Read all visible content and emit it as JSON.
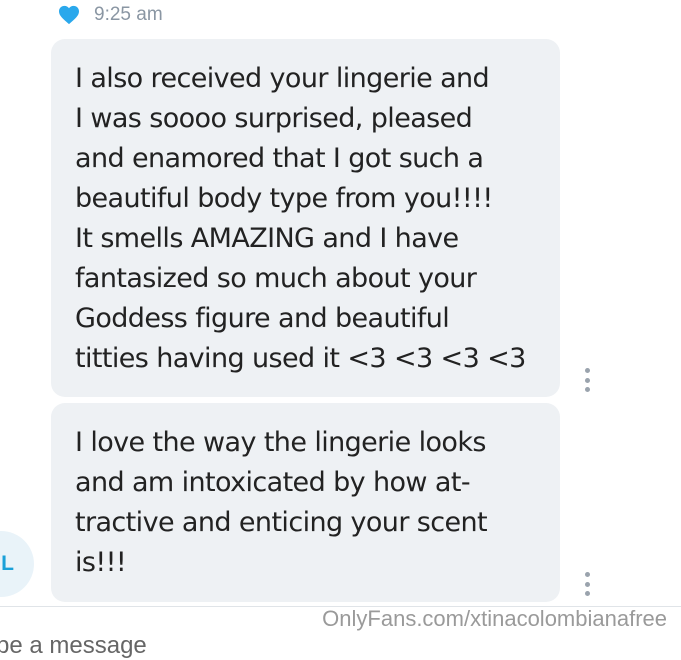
{
  "header": {
    "icon": "heart-icon",
    "time": "9:25 am",
    "heart_color": "#2aa8ec"
  },
  "messages": [
    {
      "lines": [
        "I also received your lingerie and",
        "I was soooo surprised, pleased",
        "and enamored that I got such a",
        "beautiful body type from you!!!!",
        "It smells AMAZING and I have",
        "fantasized so much about your",
        "Goddess figure and beautiful",
        "titties having used it <3 <3 <3 <3"
      ]
    },
    {
      "lines": [
        "I love the way the lingerie looks",
        "and am intoxicated by how at-",
        "tractive and enticing your scent",
        "is!!!"
      ]
    }
  ],
  "avatar": {
    "initial": "L"
  },
  "input": {
    "placeholder": "pe a message"
  },
  "watermark": "OnlyFans.com/xtinacolombianafree",
  "colors": {
    "bubble": "#eef1f4",
    "accent": "#1aa0d8"
  }
}
